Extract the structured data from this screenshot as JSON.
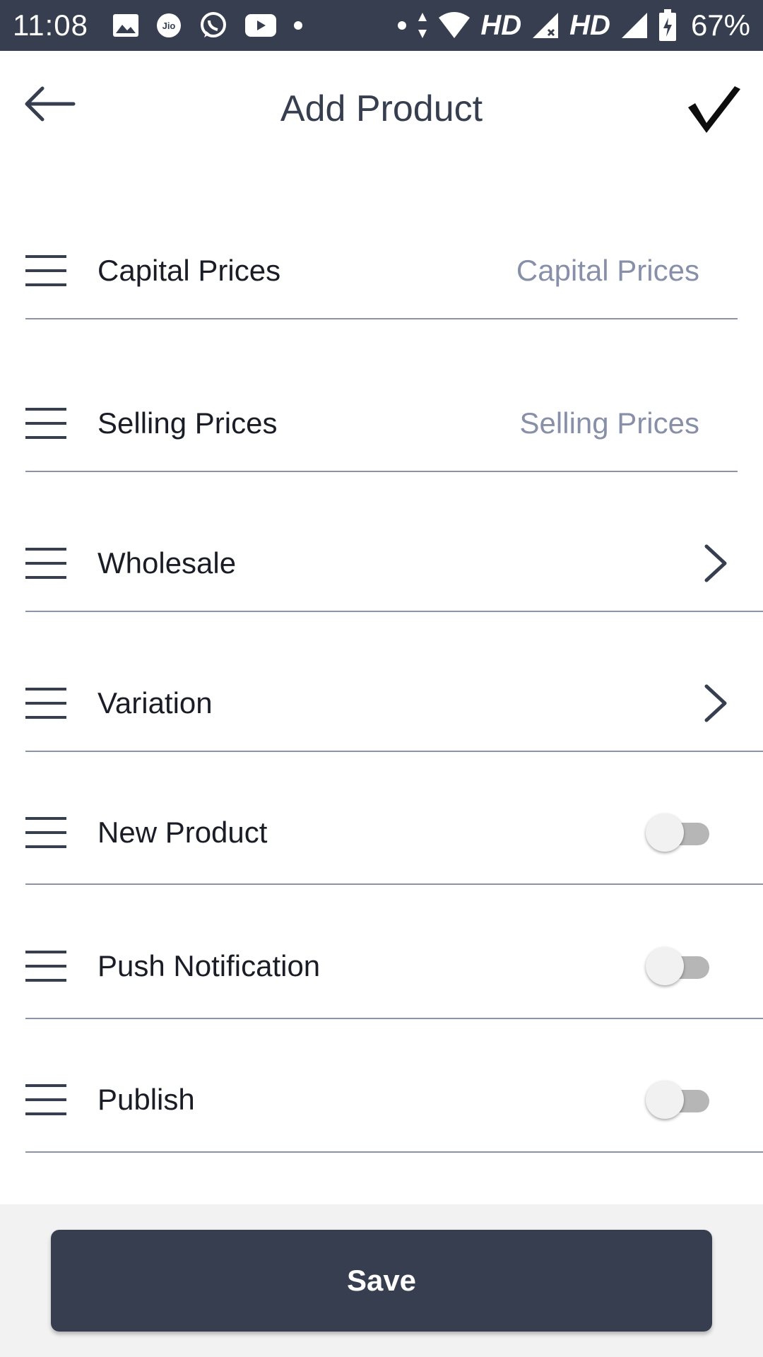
{
  "status_bar": {
    "time": "11:08",
    "network_label_1": "HD",
    "network_label_2": "HD",
    "battery": "67%",
    "icons": [
      "gallery-icon",
      "jio-icon",
      "whatsapp-icon",
      "youtube-icon",
      "dot-icon",
      "dot-icon",
      "data-arrows-icon",
      "wifi-icon",
      "signal-icon",
      "signal-no-data-icon",
      "battery-charging-icon"
    ]
  },
  "header": {
    "title": "Add Product",
    "back_icon": "arrow-left-icon",
    "confirm_icon": "check-icon"
  },
  "form": {
    "capital_prices": {
      "label": "Capital Prices",
      "placeholder": "Capital Prices",
      "value": ""
    },
    "selling_prices": {
      "label": "Selling Prices",
      "placeholder": "Selling Prices",
      "value": ""
    },
    "wholesale": {
      "label": "Wholesale"
    },
    "variation": {
      "label": "Variation"
    },
    "new_product": {
      "label": "New Product",
      "enabled": false
    },
    "push_notification": {
      "label": "Push Notification",
      "enabled": false
    },
    "publish": {
      "label": "Publish",
      "enabled": false
    }
  },
  "footer": {
    "save_label": "Save"
  },
  "colors": {
    "primary_dark": "#363e4f",
    "placeholder": "#8890a9",
    "divider": "#8d93a6",
    "footer_bg": "#f2f2f2"
  }
}
